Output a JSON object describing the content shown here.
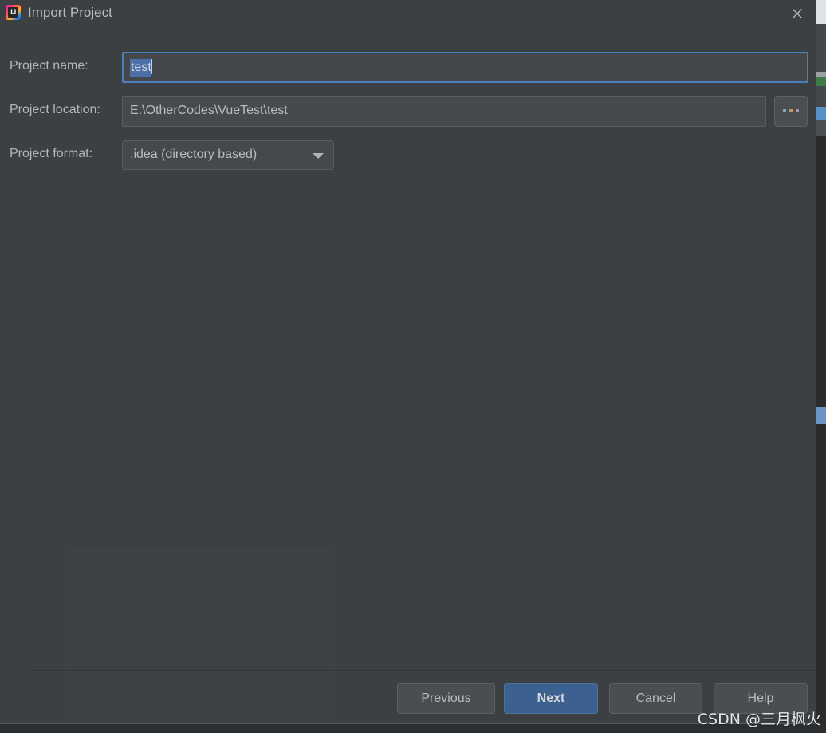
{
  "window": {
    "title": "Import Project",
    "app_icon": "intellij-idea-icon",
    "close_icon": "close-icon"
  },
  "form": {
    "project_name": {
      "label": "Project name:",
      "value": "test",
      "selected": true,
      "focused": true
    },
    "project_location": {
      "label": "Project location:",
      "value": "E:\\OtherCodes\\VueTest\\test",
      "browse_label": "...",
      "browse_icon": "ellipsis-icon"
    },
    "project_format": {
      "label": "Project format:",
      "value": ".idea (directory based)",
      "dropdown_icon": "chevron-down-icon"
    }
  },
  "buttons": {
    "previous": "Previous",
    "next": "Next",
    "cancel": "Cancel",
    "help": "Help"
  },
  "watermark": {
    "text": "CSDN @三月枫火"
  },
  "colors": {
    "dialog_background": "#3c4043",
    "text_primary": "#b9bcc0",
    "focus_border": "#4a80c0",
    "selection": "#4d6fa8",
    "primary_button": "#3c6090",
    "secondary_button": "#4a4e51"
  }
}
